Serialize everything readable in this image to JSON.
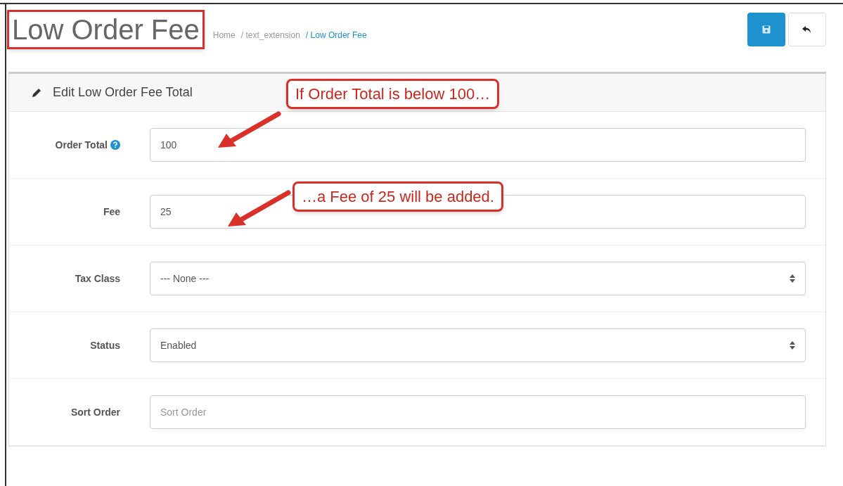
{
  "header": {
    "title": "Low Order Fee",
    "breadcrumb": [
      {
        "label": "Home",
        "selected": false
      },
      {
        "label": "/ text_extension",
        "selected": false
      },
      {
        "label": "/ Low Order Fee",
        "selected": true
      }
    ]
  },
  "panel": {
    "title": "Edit Low Order Fee Total",
    "fields": [
      {
        "kind": "input",
        "label": "Order Total",
        "help": true,
        "value": "100"
      },
      {
        "kind": "input",
        "label": "Fee",
        "help": false,
        "value": "25"
      },
      {
        "kind": "select",
        "label": "Tax Class",
        "help": false,
        "value": "--- None ---"
      },
      {
        "kind": "select",
        "label": "Status",
        "help": false,
        "value": "Enabled"
      },
      {
        "kind": "input",
        "label": "Sort Order",
        "help": false,
        "placeholder": "Sort Order"
      }
    ]
  },
  "annotations": [
    "If Order Total is below 100…",
    "…a Fee of 25 will be added."
  ]
}
